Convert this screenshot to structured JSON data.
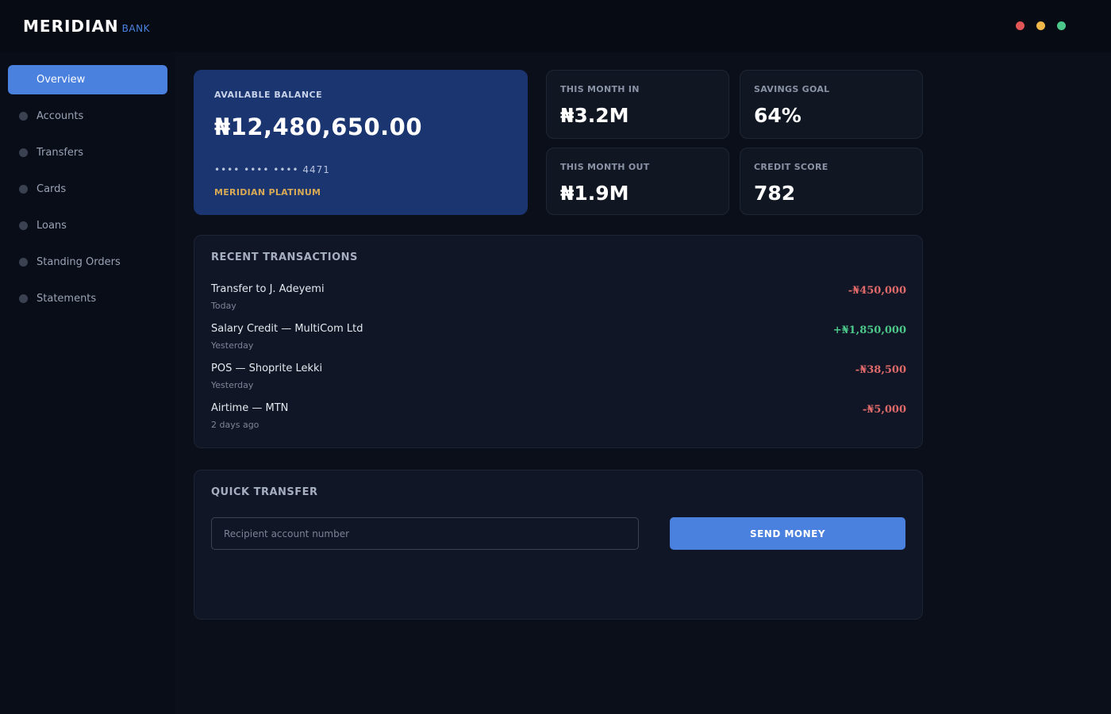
{
  "brand": {
    "name": "MERIDIAN",
    "sub": "BANK"
  },
  "window_controls": [
    {
      "name": "close-dot",
      "color": "#e05555"
    },
    {
      "name": "minimize-dot",
      "color": "#f0b84a"
    },
    {
      "name": "maximize-dot",
      "color": "#4cc98a"
    }
  ],
  "sidebar": {
    "items": [
      {
        "label": "Overview",
        "active": true
      },
      {
        "label": "Accounts",
        "active": false
      },
      {
        "label": "Transfers",
        "active": false
      },
      {
        "label": "Cards",
        "active": false
      },
      {
        "label": "Loans",
        "active": false
      },
      {
        "label": "Standing Orders",
        "active": false
      },
      {
        "label": "Statements",
        "active": false
      }
    ]
  },
  "balance": {
    "label": "AVAILABLE BALANCE",
    "amount": "₦12,480,650.00",
    "card_number": "•••• •••• •••• 4471",
    "tier": "MERIDIAN PLATINUM"
  },
  "stats": {
    "month_in": {
      "label": "THIS MONTH IN",
      "value": "₦3.2M"
    },
    "savings_goal": {
      "label": "SAVINGS GOAL",
      "value": "64%"
    },
    "month_out": {
      "label": "THIS MONTH OUT",
      "value": "₦1.9M"
    },
    "credit_score": {
      "label": "CREDIT SCORE",
      "value": "782"
    }
  },
  "transactions": {
    "title": "RECENT TRANSACTIONS",
    "items": [
      {
        "title": "Transfer to J. Adeyemi",
        "date": "Today",
        "amount": "-₦450,000",
        "type": "debit"
      },
      {
        "title": "Salary Credit — MultiCom Ltd",
        "date": "Yesterday",
        "amount": "+₦1,850,000",
        "type": "credit"
      },
      {
        "title": "POS — Shoprite Lekki",
        "date": "Yesterday",
        "amount": "-₦38,500",
        "type": "debit"
      },
      {
        "title": "Airtime — MTN",
        "date": "2 days ago",
        "amount": "-₦5,000",
        "type": "debit"
      }
    ]
  },
  "quick_transfer": {
    "title": "QUICK TRANSFER",
    "input_value": "",
    "input_placeholder": "Recipient account number",
    "button_label": "SEND MONEY"
  },
  "colors": {
    "accent": "#4a80de",
    "credit": "#4cc98a",
    "debit": "#e06a6a",
    "tier_gold": "#d7a955",
    "balance_card": "#1b3570"
  }
}
